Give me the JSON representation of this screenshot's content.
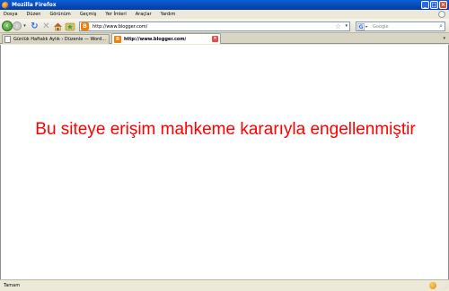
{
  "window": {
    "title": "Mozilla Firefox",
    "controls": [
      "minimize-icon",
      "maximize-icon",
      "close-icon"
    ]
  },
  "menubar": {
    "items": [
      "Dosya",
      "Düzen",
      "Görünüm",
      "Geçmiş",
      "Yer İmleri",
      "Araçlar",
      "Yardım"
    ]
  },
  "navbar": {
    "url": "http://www.blogger.com/",
    "search_placeholder": "Google",
    "search_engine_icon": "google-icon"
  },
  "tabs": [
    {
      "label": "Günlük Haftalık Aylık › Düzenle — Word...",
      "active": false
    },
    {
      "label": "http://www.blogger.com/",
      "active": true
    }
  ],
  "content": {
    "message": "Bu siteye erişim mahkeme kararıyla engellenmiştir",
    "message_color": "#ff0000"
  },
  "statusbar": {
    "text": "Tamam"
  }
}
